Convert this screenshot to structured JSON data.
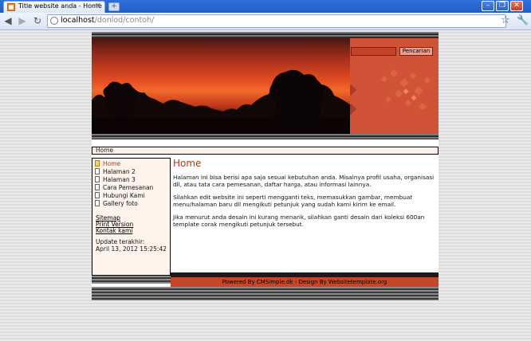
{
  "browser": {
    "tab_title": "Title website anda - Home",
    "tab_close": "×",
    "new_tab": "+",
    "url_host": "localhost",
    "url_path": "/donlod/contoh/"
  },
  "site": {
    "search": {
      "placeholder": "",
      "button": "Pencarian"
    },
    "breadcrumb": "Home",
    "nav": [
      {
        "label": "Home",
        "active": true
      },
      {
        "label": "Halaman 2"
      },
      {
        "label": "Halaman 3"
      },
      {
        "label": "Cara Pemesanan"
      },
      {
        "label": "Hubungi Kami"
      },
      {
        "label": "Gallery foto"
      }
    ],
    "links": [
      "Sitemap",
      "Print Version",
      "Kontak kami"
    ],
    "update_label": "Update terakhir:",
    "update_value": "April 13, 2012 15:25:42",
    "content": {
      "title": "Home",
      "paragraphs": [
        "Halaman ini bisa berisi apa saja sesuai kebutuhan anda. Misalnya profil usaha, organisasi dll, atau tata cara pemesanan, daftar harga, atau informasi lainnya.",
        "Silahkan edit website ini seperti mengganti teks, memasukkan gambar, membuat menu/halaman baru dll mengikuti petunjuk yang sudah kami kirim ke email.",
        "Jika menurut anda desain ini kurang menarik, silahkan ganti desain dari koleksi 600an template corak mengikuti petunjuk tersebut."
      ]
    },
    "footer": "Powered By CMSimple.dk - Design By Websitetemplate.org"
  }
}
